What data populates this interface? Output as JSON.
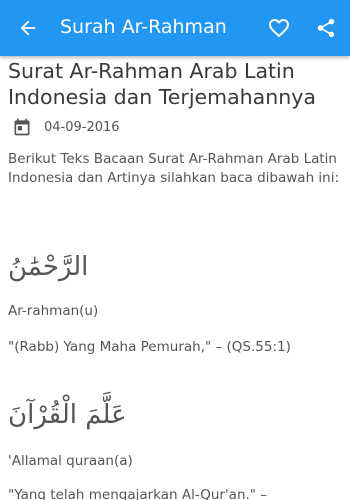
{
  "appbar": {
    "title": "Surah Ar-Rahman",
    "back_icon": "arrow-back-icon",
    "favorite_icon": "heart-outline-icon",
    "share_icon": "share-icon",
    "color": "#2196f3"
  },
  "article": {
    "title": "Surat Ar-Rahman Arab Latin Indonesia dan Terjemahannya",
    "date": "04-09-2016",
    "date_icon": "calendar-icon",
    "intro": "Berikut Teks Bacaan Surat Ar-Rahman Arab Latin Indonesia dan Artinya silahkan baca dibawah ini:",
    "verses": [
      {
        "arabic": "الرَّحْمَٰنُ",
        "latin": "Ar-rahman(u)",
        "meaning": "\"(Rabb) Yang Maha Pemurah,\" – (QS.55:1)"
      },
      {
        "arabic": "عَلَّمَ الْقُرْآنَ",
        "latin": "'Allamal quraan(a)",
        "meaning": "\"Yang telah mengajarkan Al-Qur'an.\" –"
      }
    ]
  }
}
